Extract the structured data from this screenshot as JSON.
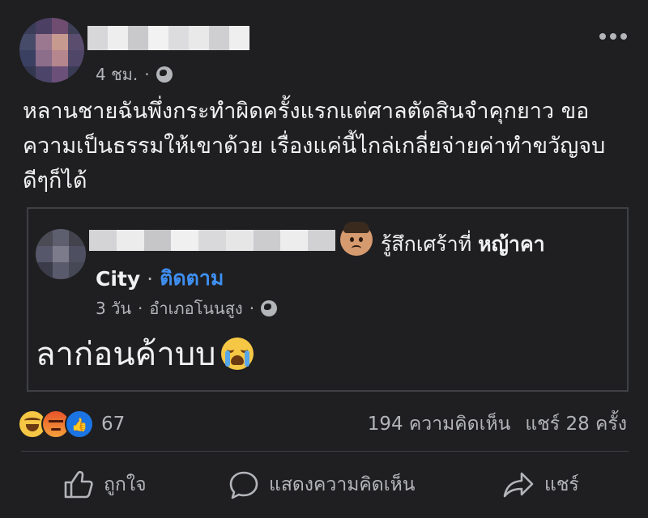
{
  "post": {
    "time": "4 ชม.",
    "dot": "·",
    "text": "หลานชายฉันพึ่งกระทำผิดครั้งแรกแต่ศาลตัดสินจำคุกยาว ขอความเป็นธรรมให้เขาด้วย เรื่องแค่นี้ไกล่เกลี่ยจ่ายค่าทำขวัญจบดีๆก็ได้"
  },
  "shared": {
    "feeling_prefix": "รู้สึกเศร้าที่",
    "feeling_place": "หญ้าคา",
    "page": "City",
    "dot": "·",
    "follow": "ติดตาม",
    "time": "3 วัน",
    "location": "อำเภอโนนสูง",
    "text": "ลาก่อนค้าบบ"
  },
  "stats": {
    "reaction_count": "67",
    "comments": "194 ความคิดเห็น",
    "shares": "แชร์ 28 ครั้ง"
  },
  "actions": {
    "like": "ถูกใจ",
    "comment": "แสดงความคิดเห็น",
    "share": "แชร์"
  },
  "colors": {
    "background": "#1f1f21",
    "text": "#e6e7ea",
    "muted": "#b3b5b9",
    "link": "#3f8ff2"
  },
  "icons": [
    "globe-icon",
    "more-icon",
    "sad-face-icon",
    "crying-face-icon",
    "haha-icon",
    "angry-icon",
    "like-icon",
    "comment-icon",
    "share-icon"
  ]
}
